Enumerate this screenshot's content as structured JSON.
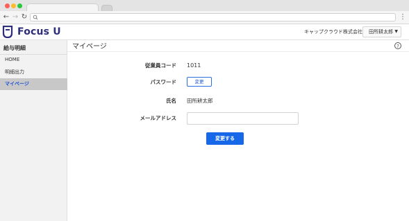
{
  "browser": {
    "url": ""
  },
  "header": {
    "logo_text": "Focus U",
    "company": "キャップクラウド株式会社",
    "user": "田所耕太郎"
  },
  "sidebar": {
    "heading": "給与明細",
    "items": [
      {
        "label": "HOME",
        "active": false
      },
      {
        "label": "明細出力",
        "active": false
      },
      {
        "label": "マイページ",
        "active": true
      }
    ]
  },
  "page": {
    "title": "マイページ"
  },
  "form": {
    "employee_code_label": "従業員コード",
    "employee_code": "1011",
    "password_label": "パスワード",
    "password_change_button": "変更",
    "name_label": "氏名",
    "name": "田所耕太郎",
    "email_label": "メールアドレス",
    "email_value": "",
    "submit_button": "変更する"
  },
  "colors": {
    "brand": "#2d2d7a",
    "accent": "#1668e8",
    "active_nav_text": "#1b4fd6",
    "active_nav_bg": "#c8c8c8"
  }
}
